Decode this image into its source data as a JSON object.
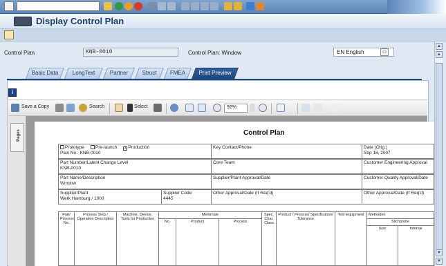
{
  "window": {
    "title": "Display Control Plan"
  },
  "header": {
    "control_plan_label": "Control Plan",
    "control_plan_value": "KNB-0010",
    "control_plan_desc": "Control Plan: Window",
    "language_value": "EN English"
  },
  "tabs": [
    {
      "label": "Basic Data"
    },
    {
      "label": "LongText"
    },
    {
      "label": "Partner"
    },
    {
      "label": "Struct"
    },
    {
      "label": "FMEA"
    },
    {
      "label": "Print Preview",
      "active": true
    }
  ],
  "pdf_toolbar": {
    "save_copy": "Save a Copy",
    "search": "Search",
    "select": "Select",
    "zoom": "92%",
    "pages_tab": "Pages"
  },
  "document": {
    "title": "Control Plan",
    "row1": {
      "prototype": "Prototype",
      "prelaunch": "Pre-launch",
      "production": "Production",
      "production_mark": "X",
      "plan_no": "Plan No.: KNB-0010",
      "key_contact": "Key Contact/Phone",
      "date_label": "Date (Orig.)",
      "date_value": "Sep 18, 2007"
    },
    "row2": {
      "part_number_label": "Part Number/Latest Change Level",
      "part_number_value": "KNB-0010",
      "core_team": "Core Team",
      "customer_eng": "Customer Engineering Approval"
    },
    "row3": {
      "part_name_label": "Part Name/Description",
      "part_name_value": "Window",
      "supplier_approval": "Supplier/Plant Approval/Date",
      "customer_quality": "Customer Quality Approval/Date"
    },
    "row4": {
      "supplier_label": "Supplier/Plant",
      "supplier_value": "Werk Hamburg / 1000",
      "supplier_code_label": "Supplier Code",
      "supplier_code_value": "4445",
      "other_approval_1": "Other Approval/Date (If Req'd)",
      "other_approval_2": "Other Approval/Date (If Req'd)"
    },
    "table_headers": {
      "part_process_no": "Part/ Process No.",
      "process_step": "Process Step / Operation Description",
      "machine": "Machine, Device, Tools for Production",
      "merkmale": "Merkmale",
      "no": "No.",
      "product": "Product",
      "process": "Process",
      "spec_char": "Spec. Char. Class",
      "product_process_spec": "Product / Process/ Specification/ Tolerance",
      "test_equipment": "Test Equipment",
      "methoden": "Methoden",
      "stichprobe": "Stichprobe",
      "size": "Size",
      "interval": "Interval"
    }
  }
}
